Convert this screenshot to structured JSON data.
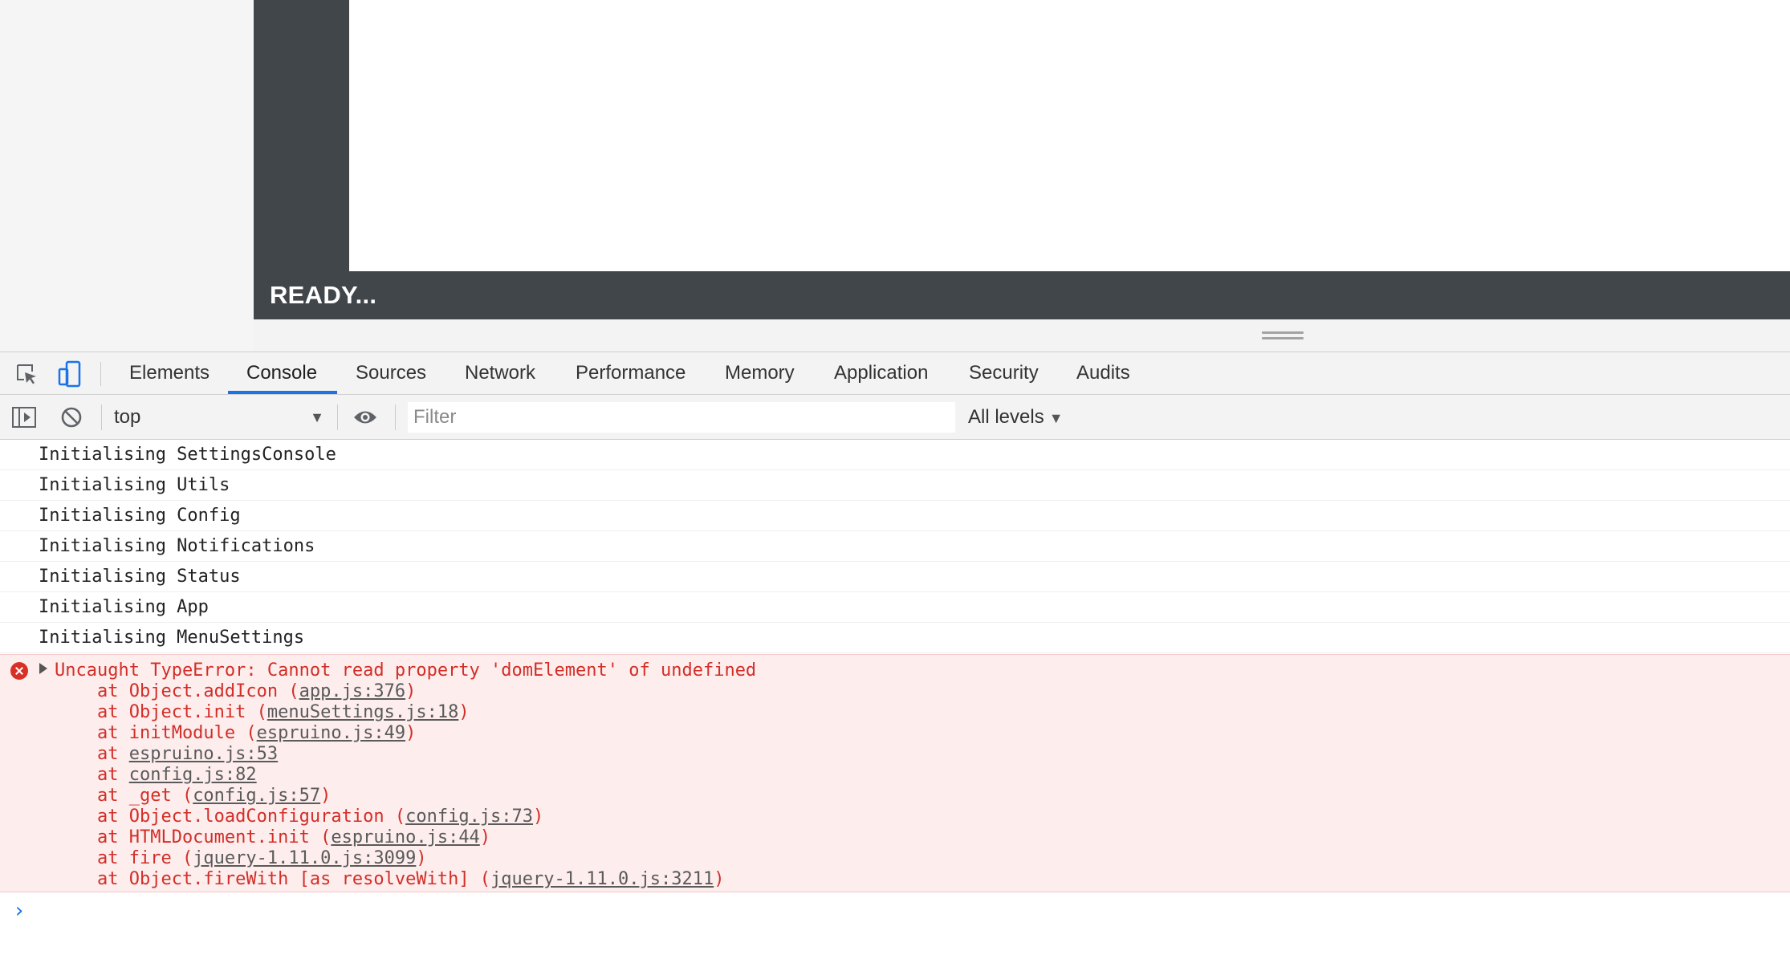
{
  "app": {
    "status_text": "READY..."
  },
  "devtools": {
    "tabs": [
      {
        "label": "Elements",
        "active": false
      },
      {
        "label": "Console",
        "active": true
      },
      {
        "label": "Sources",
        "active": false
      },
      {
        "label": "Network",
        "active": false
      },
      {
        "label": "Performance",
        "active": false
      },
      {
        "label": "Memory",
        "active": false
      },
      {
        "label": "Application",
        "active": false
      },
      {
        "label": "Security",
        "active": false
      },
      {
        "label": "Audits",
        "active": false
      }
    ],
    "accent_color": "#1a73e8"
  },
  "console_toolbar": {
    "context_value": "top",
    "filter_placeholder": "Filter",
    "levels_label": "All levels"
  },
  "messages": [
    "Initialising SettingsConsole",
    "Initialising Utils",
    "Initialising Config",
    "Initialising Notifications",
    "Initialising Status",
    "Initialising App",
    "Initialising MenuSettings"
  ],
  "error": {
    "message": "Uncaught TypeError: Cannot read property 'domElement' of undefined",
    "color": "#d22e27",
    "stack": [
      {
        "prefix": "    at Object.addIcon (",
        "link": "app.js:376",
        "suffix": ")"
      },
      {
        "prefix": "    at Object.init (",
        "link": "menuSettings.js:18",
        "suffix": ")"
      },
      {
        "prefix": "    at initModule (",
        "link": "espruino.js:49",
        "suffix": ")"
      },
      {
        "prefix": "    at ",
        "link": "espruino.js:53",
        "suffix": ""
      },
      {
        "prefix": "    at ",
        "link": "config.js:82",
        "suffix": ""
      },
      {
        "prefix": "    at _get (",
        "link": "config.js:57",
        "suffix": ")"
      },
      {
        "prefix": "    at Object.loadConfiguration (",
        "link": "config.js:73",
        "suffix": ")"
      },
      {
        "prefix": "    at HTMLDocument.init (",
        "link": "espruino.js:44",
        "suffix": ")"
      },
      {
        "prefix": "    at fire (",
        "link": "jquery-1.11.0.js:3099",
        "suffix": ")"
      },
      {
        "prefix": "    at Object.fireWith [as resolveWith] (",
        "link": "jquery-1.11.0.js:3211",
        "suffix": ")"
      }
    ]
  },
  "icons": {
    "inspect": "inspect-element-icon",
    "device": "device-toolbar-icon",
    "sidebar": "show-sidebar-icon",
    "clear": "clear-console-icon",
    "eye": "live-expression-icon",
    "error": "error-icon",
    "prompt": "console-prompt-icon"
  }
}
